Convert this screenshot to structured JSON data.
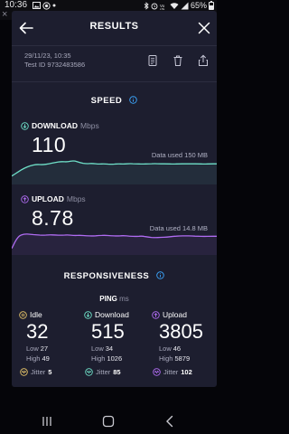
{
  "status_bar": {
    "time": "10:36",
    "battery": "65%",
    "icons": [
      "notification-icon",
      "image-icon",
      "record-icon",
      "bluetooth-icon",
      "alarm-icon",
      "volte-icon",
      "wifi-icon",
      "signal-icon",
      "battery-icon"
    ]
  },
  "header": {
    "title": "RESULTS"
  },
  "meta": {
    "datetime": "29/11/23, 10:35",
    "test_id": "Test ID 9732483586"
  },
  "speed": {
    "title": "SPEED",
    "download": {
      "label": "DOWNLOAD",
      "unit": "Mbps",
      "value": "110",
      "data_used": "Data used 150 MB",
      "color": "#6fe0c8",
      "graph": [
        0.28,
        0.45,
        0.62,
        0.72,
        0.78,
        0.76,
        0.8,
        0.86,
        0.9,
        0.88,
        0.94,
        0.85,
        0.8,
        0.82,
        0.79,
        0.8,
        0.78,
        0.8,
        0.79,
        0.81,
        0.8,
        0.79,
        0.8,
        0.81,
        0.8,
        0.8,
        0.79,
        0.8,
        0.8,
        0.8,
        0.8,
        0.79,
        0.8,
        0.8
      ]
    },
    "upload": {
      "label": "UPLOAD",
      "unit": "Mbps",
      "value": "8.78",
      "data_used": "Data used 14.8 MB",
      "color": "#b06cf2",
      "graph": [
        0.2,
        0.72,
        0.82,
        0.8,
        0.78,
        0.76,
        0.78,
        0.77,
        0.76,
        0.78,
        0.75,
        0.76,
        0.74,
        0.73,
        0.75,
        0.76,
        0.74,
        0.73,
        0.75,
        0.72,
        0.71,
        0.73,
        0.68,
        0.66,
        0.67,
        0.68,
        0.72,
        0.73,
        0.74,
        0.73,
        0.72,
        0.71,
        0.72,
        0.72
      ]
    }
  },
  "responsiveness": {
    "title": "RESPONSIVENESS",
    "ping_label": "PING",
    "ping_unit": "ms",
    "columns": [
      {
        "label": "Idle",
        "value": "32",
        "low_label": "Low",
        "low": "27",
        "high_label": "High",
        "high": "49",
        "jitter_label": "Jitter",
        "jitter": "5",
        "color": "#e8c66a"
      },
      {
        "label": "Download",
        "value": "515",
        "low_label": "Low",
        "low": "34",
        "high_label": "High",
        "high": "1026",
        "jitter_label": "Jitter",
        "jitter": "85",
        "color": "#6fe0c8"
      },
      {
        "label": "Upload",
        "value": "3805",
        "low_label": "Low",
        "low": "46",
        "high_label": "High",
        "high": "5879",
        "jitter_label": "Jitter",
        "jitter": "102",
        "color": "#b06cf2"
      }
    ]
  },
  "colors": {
    "card": "#1d1e2f",
    "accent_blue": "#3ca7ff",
    "download": "#6fe0c8",
    "upload": "#b06cf2",
    "idle": "#e8c66a"
  }
}
